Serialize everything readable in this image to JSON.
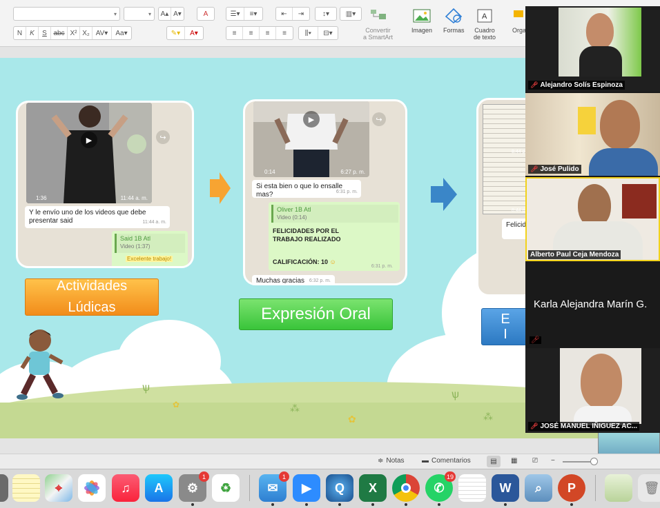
{
  "ribbon": {
    "format_buttons": [
      "N",
      "K",
      "S",
      "abc",
      "X²",
      "X₂"
    ],
    "convert_smartart": [
      "Convertir",
      "a SmartArt"
    ],
    "image_label": "Imagen",
    "shapes_label": "Formas",
    "textbox_label": [
      "Cuadro",
      "de texto"
    ],
    "org_label": "Orga"
  },
  "slide": {
    "card1": {
      "video_duration": "1:36",
      "video_time": "11:44 a. m.",
      "message": "Y le envío uno de los videos que debe presentar said",
      "message_time": "11:44 a. m.",
      "reply_name": "Said 1B Atl",
      "reply_meta": "Video (1:37)",
      "sticker_text": "Excelente trabajo!"
    },
    "card2": {
      "video_duration": "0:14",
      "video_time": "6:27 p. m.",
      "question": "Si esta bien o que lo ensalle mas?",
      "question_time": "6:31 p. m.",
      "reply_name": "Oliver 1B Atl",
      "reply_meta": "Video (0:14)",
      "congrats": "FELICIDADES POR EL TRABAJO REALIZADO",
      "grade": "CALIFICACIÓN: 10",
      "grade_time": "6:31 p. m.",
      "thanks": "Muchas gracias",
      "thanks_time": "6:32 p. m."
    },
    "card3": {
      "time1": "8:44 p",
      "time2": "8:44 p",
      "partial": "Felicid"
    },
    "label1": [
      "Actividades",
      "Lúdicas"
    ],
    "label2": "Expresión Oral",
    "label3": [
      "E",
      "I"
    ]
  },
  "participants": [
    {
      "name": "Alejandro Solís Espinoza",
      "muted": true
    },
    {
      "name": "José Pulido",
      "muted": true
    },
    {
      "name": "Alberto Paul Ceja Mendoza",
      "muted": false,
      "active": true
    },
    {
      "name": "Karla Alejandra Marín G.",
      "muted": true,
      "video_off": true
    },
    {
      "name": "JOSÉ MANUEL IÑIGUEZ AC...",
      "muted": true
    }
  ],
  "statusbar": {
    "notes": "Notas",
    "comments": "Comentarios"
  },
  "dock": {
    "system_prefs_badge": "1",
    "mail_badge": "1",
    "whatsapp_badge": "19"
  },
  "colors": {
    "slide_bg": "#a9e8ea",
    "orange": "#f7a432",
    "green": "#5cd65c",
    "blue": "#3a86c8"
  }
}
